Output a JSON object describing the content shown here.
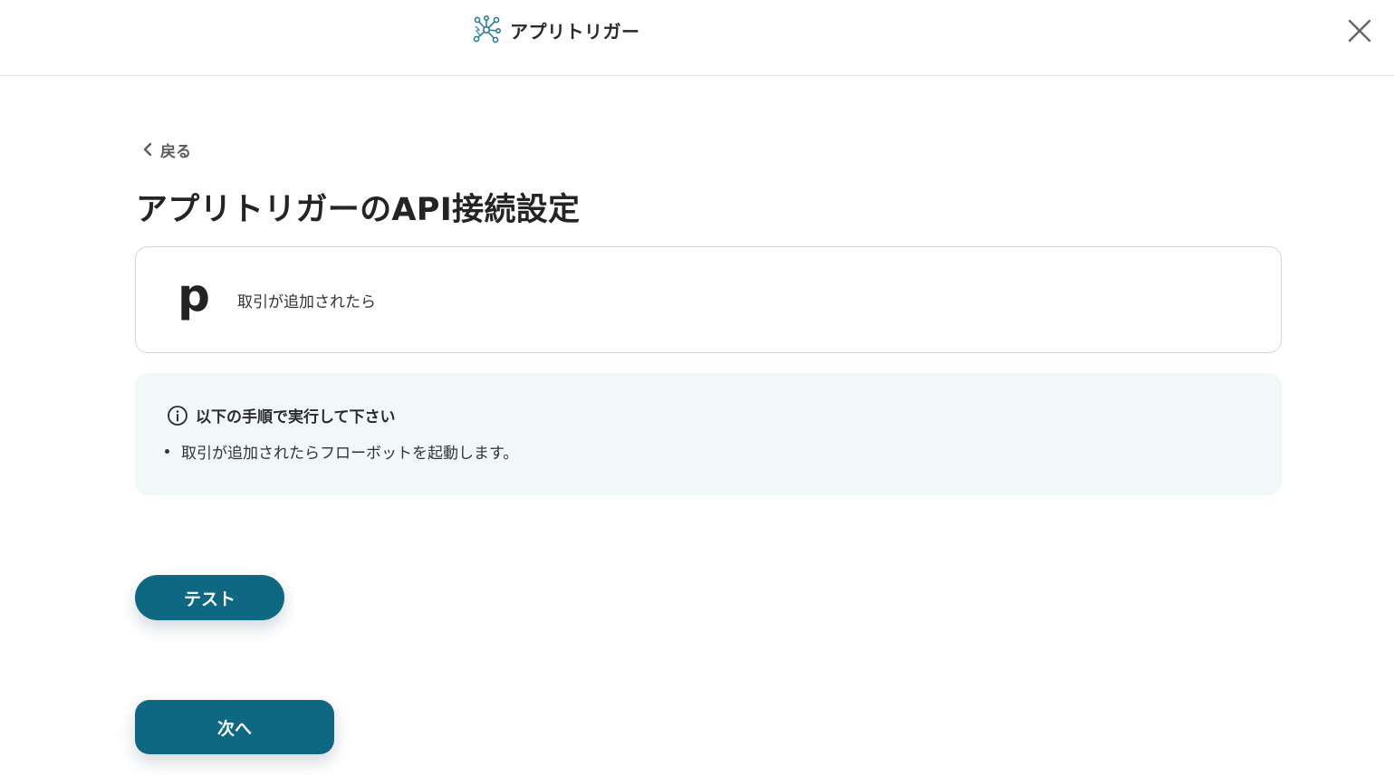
{
  "header": {
    "app_title": "アプリトリガー",
    "logo_icon": "network-nodes-icon",
    "close_icon": "close-icon"
  },
  "nav": {
    "back_label": "戻る",
    "back_icon": "chevron-left-icon"
  },
  "page": {
    "title": "アプリトリガーのAPI接続設定"
  },
  "trigger": {
    "app_logo_text": "p",
    "label": "取引が追加されたら"
  },
  "info": {
    "icon": "info-icon",
    "title": "以下の手順で実行して下さい",
    "steps": [
      "取引が追加されたらフローボットを起動します。"
    ]
  },
  "actions": {
    "test_label": "テスト",
    "next_label": "次へ"
  },
  "colors": {
    "primary": "#0e6882",
    "info_bg": "#f1f9f8",
    "brand_teal": "#2a7f8f"
  }
}
